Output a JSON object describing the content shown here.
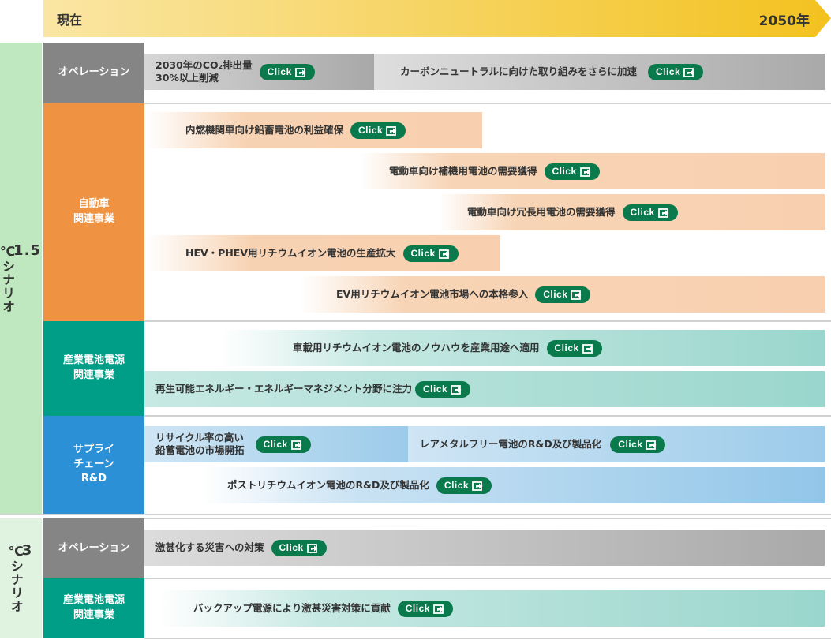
{
  "timeline": {
    "start_label": "現在",
    "end_label": "2050年"
  },
  "colors": {
    "timeline_start": "#f9e4a0",
    "timeline_end": "#f3c21f",
    "scenario_15": "#bfe8c0",
    "scenario_3": "#dff3e0",
    "operation": "#858585",
    "automotive": "#ef9241",
    "industrial": "#009e87",
    "supply_chain": "#2b90d6",
    "click_button": "#0a7a4c"
  },
  "click_label": "Click",
  "scenarios": [
    {
      "label_num": "1.5",
      "label_text": "℃シナリオ",
      "categories": [
        {
          "label": "オペレーション",
          "items": [
            {
              "text": "2030年のCO₂排出量\n30%以上削減",
              "button": "Click"
            },
            {
              "text": "カーボンニュートラルに向けた取り組みをさらに加速",
              "button": "Click"
            }
          ]
        },
        {
          "label": "自動車\n関連事業",
          "items": [
            {
              "text": "内燃機関車向け鉛蓄電池の利益確保",
              "button": "Click"
            },
            {
              "text": "電動車向け補機用電池の需要獲得",
              "button": "Click"
            },
            {
              "text": "電動車向け冗長用電池の需要獲得",
              "button": "Click"
            },
            {
              "text": "HEV・PHEV用リチウムイオン電池の生産拡大",
              "button": "Click"
            },
            {
              "text": "EV用リチウムイオン電池市場への本格参入",
              "button": "Click"
            }
          ]
        },
        {
          "label": "産業電池電源\n関連事業",
          "items": [
            {
              "text": "車載用リチウムイオン電池のノウハウを産業用途へ適用",
              "button": "Click"
            },
            {
              "text": "再生可能エネルギー・エネルギーマネジメント分野に注力",
              "button": "Click"
            }
          ]
        },
        {
          "label": "サプライ\nチェーン\nR&D",
          "items": [
            {
              "text": "リサイクル率の高い\n鉛蓄電池の市場開拓",
              "button": "Click"
            },
            {
              "text": "レアメタルフリー電池のR&D及び製品化",
              "button": "Click"
            },
            {
              "text": "ポストリチウムイオン電池のR&D及び製品化",
              "button": "Click"
            }
          ]
        }
      ]
    },
    {
      "label_num": "3",
      "label_text": "℃シナリオ",
      "categories": [
        {
          "label": "オペレーション",
          "items": [
            {
              "text": "激甚化する災害への対策",
              "button": "Click"
            }
          ]
        },
        {
          "label": "産業電池電源\n関連事業",
          "items": [
            {
              "text": "バックアップ電源により激甚災害対策に貢献",
              "button": "Click"
            }
          ]
        }
      ]
    }
  ]
}
